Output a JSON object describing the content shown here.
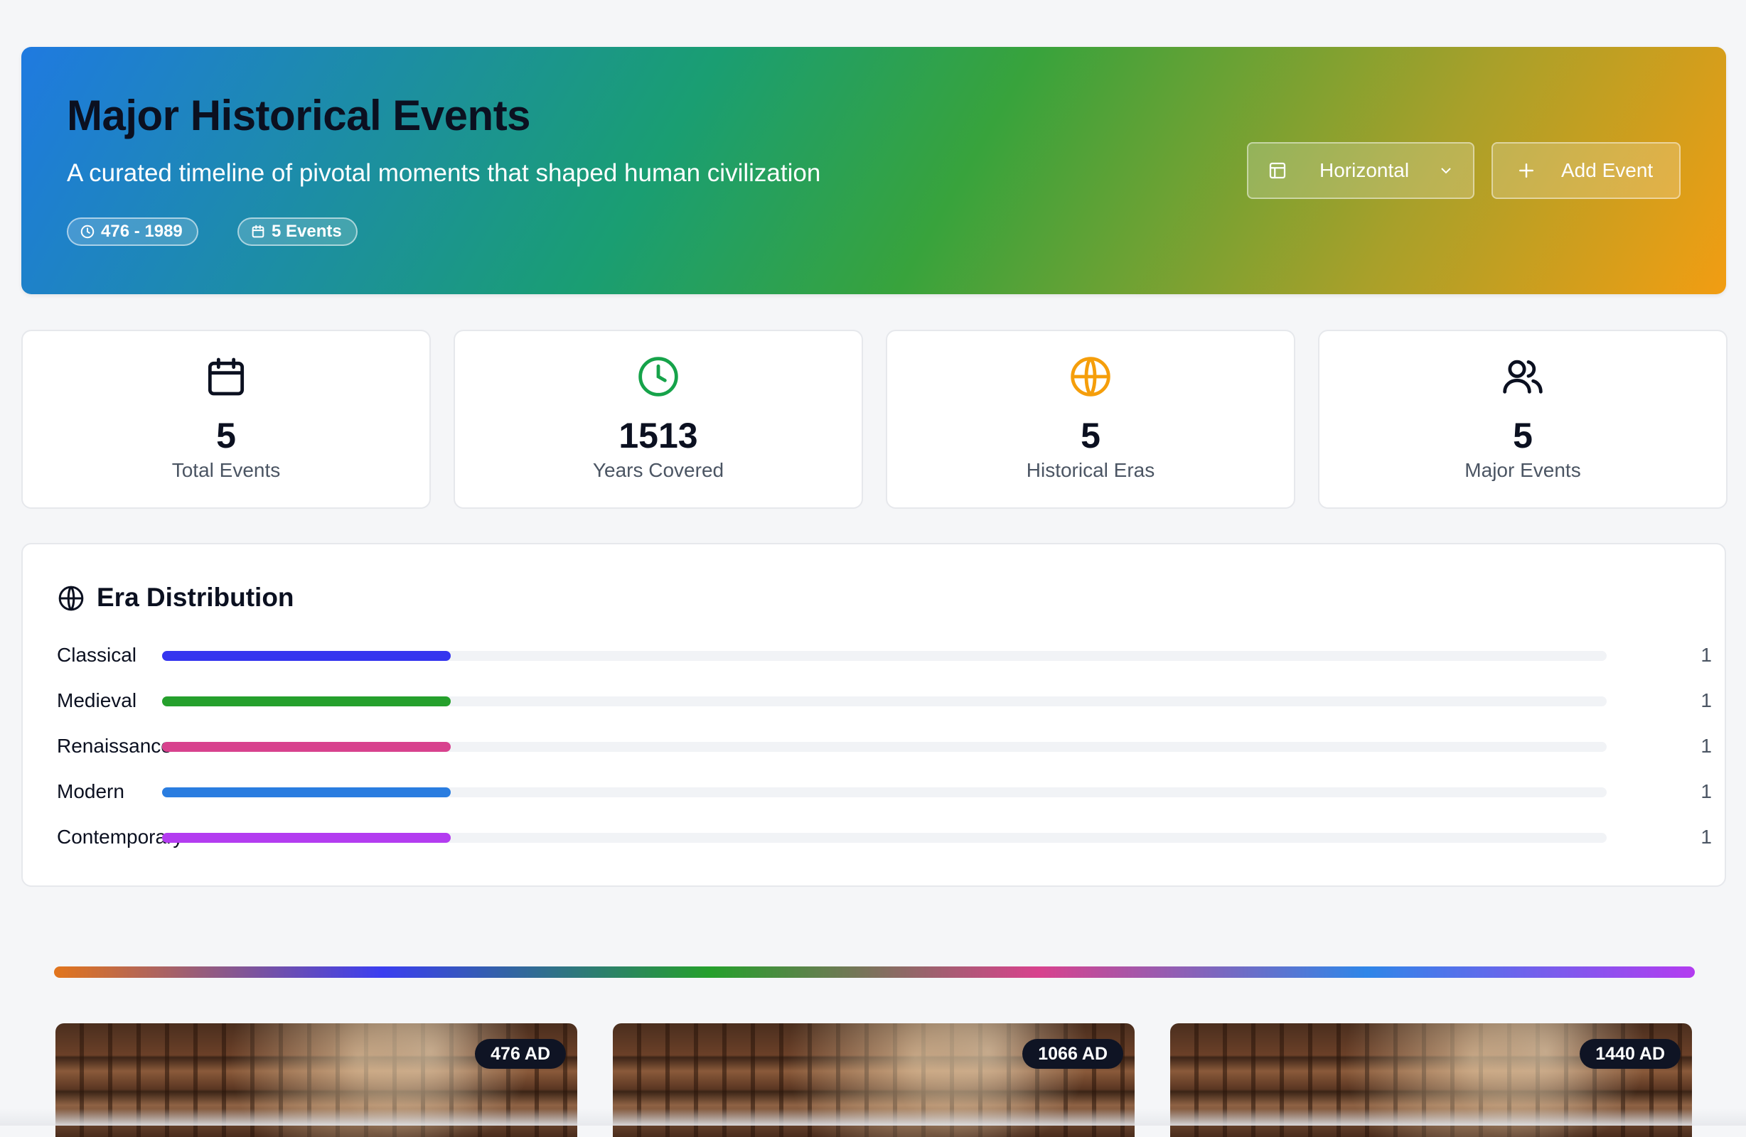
{
  "hero": {
    "title": "Major Historical Events",
    "subtitle": "A curated timeline of pivotal moments that shaped human civilization",
    "range_pill": "476 - 1989",
    "events_pill": "5 Events",
    "layout_select": "Horizontal",
    "add_button": "Add Event"
  },
  "stats": [
    {
      "value": "5",
      "label": "Total Events",
      "icon": "calendar-icon",
      "color": "#0b1020"
    },
    {
      "value": "1513",
      "label": "Years Covered",
      "icon": "clock-icon",
      "color": "#16a34a"
    },
    {
      "value": "5",
      "label": "Historical Eras",
      "icon": "globe-icon",
      "color": "#f59e0b"
    },
    {
      "value": "5",
      "label": "Major Events",
      "icon": "users-icon",
      "color": "#0b1020"
    }
  ],
  "era_distribution": {
    "title": "Era Distribution",
    "eras": [
      {
        "name": "Classical",
        "count": "1",
        "fraction": 0.2,
        "color": "#3535ef"
      },
      {
        "name": "Medieval",
        "count": "1",
        "fraction": 0.2,
        "color": "#25a02c"
      },
      {
        "name": "Renaissance",
        "count": "1",
        "fraction": 0.2,
        "color": "#d8428e"
      },
      {
        "name": "Modern",
        "count": "1",
        "fraction": 0.2,
        "color": "#2a7de0"
      },
      {
        "name": "Contemporary",
        "count": "1",
        "fraction": 0.2,
        "color": "#b33cf0"
      }
    ]
  },
  "event_cards": [
    {
      "date": "476 AD"
    },
    {
      "date": "1066 AD"
    },
    {
      "date": "1440 AD"
    }
  ]
}
